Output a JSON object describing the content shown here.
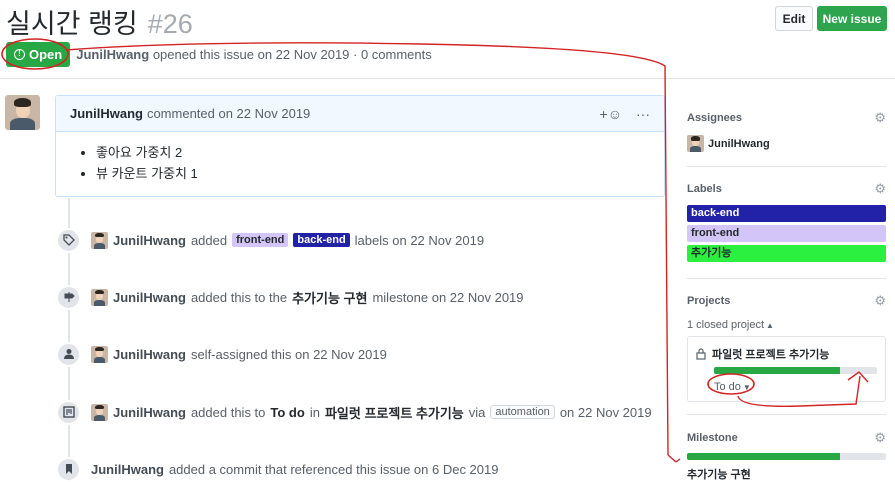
{
  "issue": {
    "title": "실시간 랭킹",
    "number": "#26",
    "state": "Open",
    "meta_author": "JunilHwang",
    "meta_rest": "opened this issue on 22 Nov 2019 · 0 comments"
  },
  "header_buttons": {
    "edit": "Edit",
    "new_issue": "New issue"
  },
  "comment": {
    "author": "JunilHwang",
    "action": "commented on 22 Nov 2019",
    "reaction_icon": "+☺",
    "more_icon": "···",
    "items": [
      "좋아요 가중치 2",
      "뷰 카운트 가중치 1"
    ]
  },
  "events": [
    {
      "icon": "tag-icon",
      "actor": "JunilHwang",
      "t1": "added",
      "label1": "front-end",
      "label2": "back-end",
      "t2": "labels on 22 Nov 2019"
    },
    {
      "icon": "milestone-icon",
      "actor": "JunilHwang",
      "t1": "added this to the",
      "strong": "추가기능 구현",
      "t2": "milestone on 22 Nov 2019"
    },
    {
      "icon": "person-icon",
      "actor": "JunilHwang",
      "t1": "self-assigned this on 22 Nov 2019"
    },
    {
      "icon": "project-icon",
      "actor": "JunilHwang",
      "t1": "added this to",
      "strong1": "To do",
      "t2": "in",
      "strong2": "파일럿 프로젝트 추가기능",
      "t3": "via",
      "chip": "automation",
      "t4": "on 22 Nov 2019"
    },
    {
      "icon": "bookmark-icon",
      "actor": "JunilHwang",
      "t1": "added a commit that referenced this issue on 6 Dec 2019"
    }
  ],
  "sidebar": {
    "assignees": {
      "title": "Assignees",
      "name": "JunilHwang"
    },
    "labels": {
      "title": "Labels",
      "items": [
        {
          "name": "back-end",
          "bg": "#2222a8",
          "fg": "#ffffff"
        },
        {
          "name": "front-end",
          "bg": "#d4c5f9",
          "fg": "#24292e"
        },
        {
          "name": "추가기능",
          "bg": "#2bf03f",
          "fg": "#24292e"
        }
      ]
    },
    "projects": {
      "title": "Projects",
      "closed": "1 closed project",
      "project_name": "파일럿 프로젝트 추가기능",
      "progress": 0.77,
      "column": "To do"
    },
    "milestone": {
      "title": "Milestone",
      "name": "추가기능 구현",
      "progress": 0.77
    }
  },
  "colors": {
    "open_green": "#28a745",
    "annotation_red": "#d32424"
  }
}
